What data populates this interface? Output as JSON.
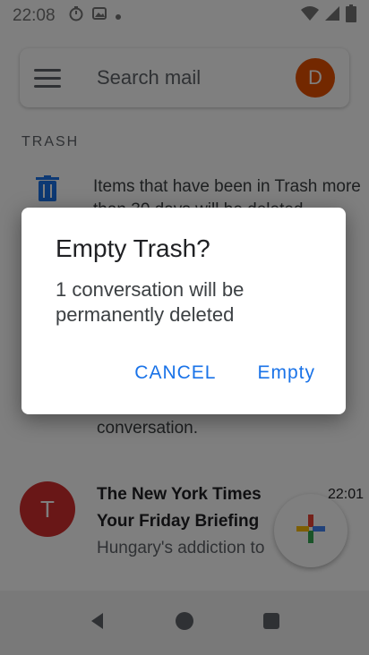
{
  "status_bar": {
    "time": "22:08"
  },
  "search": {
    "placeholder": "Search mail",
    "avatar_letter": "D"
  },
  "folder": {
    "label": "TRASH",
    "notice": "Items that have been in Trash more than 30 days will be deleted"
  },
  "conversation_tail": "conversation.",
  "mail": {
    "avatar_letter": "T",
    "sender": "The New York Times",
    "time": "22:01",
    "subject": "Your Friday Briefing",
    "preview": "Hungary's addiction to"
  },
  "dialog": {
    "title": "Empty Trash?",
    "message": "1 conversation will be permanently deleted",
    "cancel_label": "Cancel",
    "confirm_label": "Empty"
  },
  "colors": {
    "accent": "#1a73e8",
    "avatar_d": "#e65100",
    "avatar_t": "#d32f2f"
  }
}
